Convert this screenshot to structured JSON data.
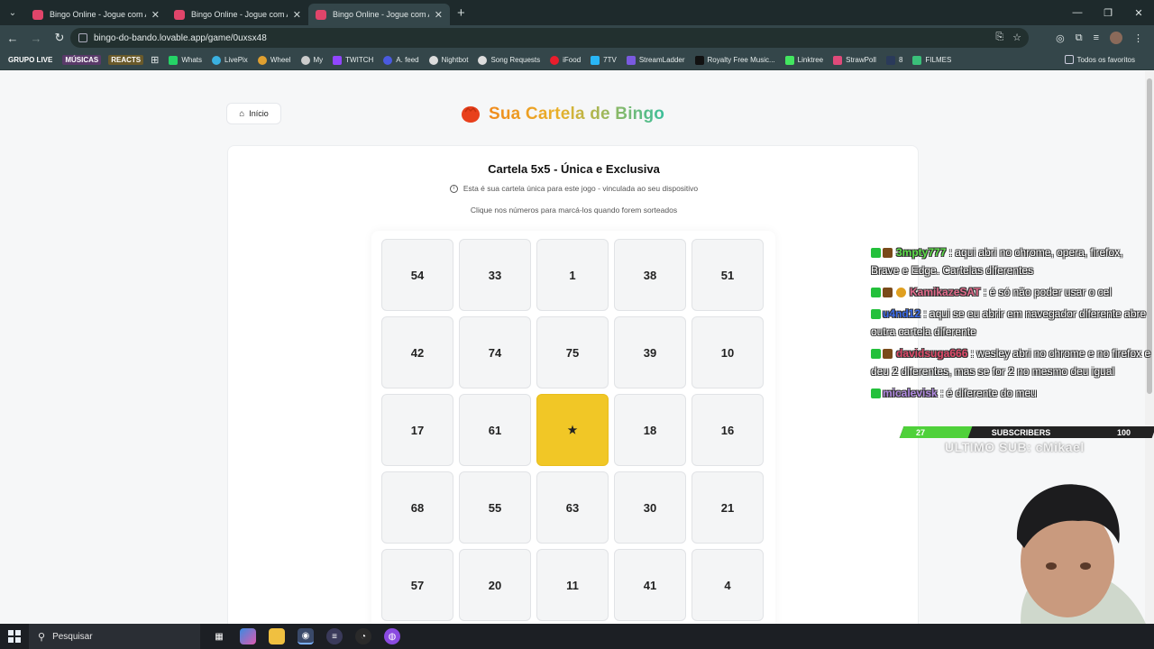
{
  "browser": {
    "tabs": [
      {
        "title": "Bingo Online - Jogue com Amig"
      },
      {
        "title": "Bingo Online - Jogue com Amig"
      },
      {
        "title": "Bingo Online - Jogue com Amig"
      }
    ],
    "url": "bingo-do-bando.lovable.app/game/0uxsx48"
  },
  "bookmarks": {
    "tags": [
      "GRUPO LIVE",
      "MÚSICAS",
      "REACTS"
    ],
    "items": [
      "Whats",
      "LivePix",
      "Wheel",
      "My",
      "TWITCH",
      "A. feed",
      "Nightbot",
      "Song Requests",
      "iFood",
      "7TV",
      "StreamLadder",
      "Royalty Free Music...",
      "Linktree",
      "StrawPoll",
      "8",
      "FILMES"
    ],
    "favorites_label": "Todos os favoritos"
  },
  "page": {
    "home_label": "Início",
    "title": "Sua Cartela de Bingo",
    "card_title": "Cartela 5x5 - Única e Exclusiva",
    "info_text": "Esta é sua cartela única para este jogo - vinculada ao seu dispositivo",
    "hint_text": "Clique nos números para marcá-los quando forem sorteados",
    "grid": [
      [
        "54",
        "33",
        "1",
        "38",
        "51"
      ],
      [
        "42",
        "74",
        "75",
        "39",
        "10"
      ],
      [
        "17",
        "61",
        "★",
        "18",
        "16"
      ],
      [
        "68",
        "55",
        "63",
        "30",
        "21"
      ],
      [
        "57",
        "20",
        "11",
        "41",
        "4"
      ]
    ],
    "free_color": "#f1c726"
  },
  "overlay": {
    "chat": [
      {
        "user": "3mpty777",
        "color": "#5ee04a",
        "text": ": aqui abri no chrome, opera, firefox, Brave e Edge. Cartelas diferentes"
      },
      {
        "user": "KamikazeSAT",
        "color": "#e06a8a",
        "text": ": é só não poder usar o cel"
      },
      {
        "user": "u4nd12",
        "color": "#3a6ae8",
        "text": ": aqui se eu abrir em navegador diferente abre outra cartela diferente"
      },
      {
        "user": "davidsuga666",
        "color": "#e04a6a",
        "text": ": wesley abri no chrome e no firefox e deu 2 diferentes, mas se for 2 no mesmo deu igual"
      },
      {
        "user": "micalevisk",
        "color": "#b08ae0",
        "text": ": é diferente do meu"
      }
    ],
    "sub_current": "27",
    "sub_label": "SUBSCRIBERS",
    "sub_goal": "100",
    "sub_progress": 0.27,
    "last_sub": "ULTIMO SUB: cMikael"
  },
  "taskbar": {
    "search_label": "Pesquisar"
  }
}
